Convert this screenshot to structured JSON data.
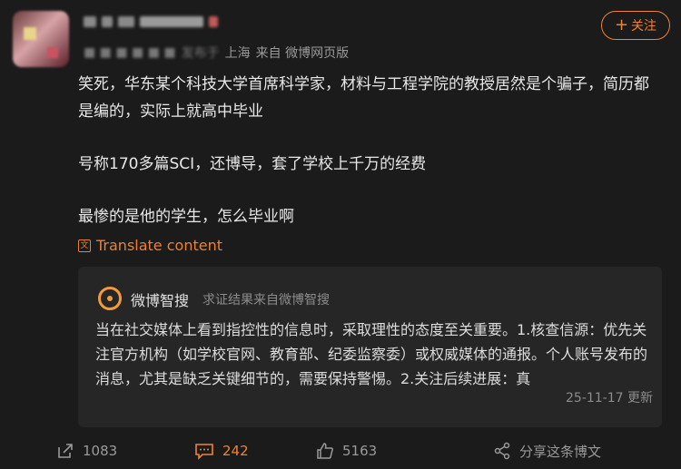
{
  "user": {
    "location_prefix": "发布于",
    "location": "上海",
    "source": "来自 微博网页版"
  },
  "follow": {
    "label": "关注",
    "icon": "plus-icon"
  },
  "post": {
    "lines": [
      "笑死，华东某个科技大学首席科学家，材料与工程学院的教授居然是个骗子，简历都是编的，实际上就高中毕业",
      "号称170多篇SCI，还博导，套了学校上千万的经费",
      "最惨的是他的学生，怎么毕业啊"
    ]
  },
  "translate": {
    "label": "Translate content",
    "icon": "translate-icon"
  },
  "card": {
    "title": "微博智搜",
    "subtitle": "求证结果来自微博智搜",
    "body": "当在社交媒体上看到指控性的信息时，采取理性的态度至关重要。1.核查信源：优先关注官方机构（如学校官网、教育部、纪委监察委）或权威媒体的通报。个人账号发布的消息，尤其是缺乏关键细节的，需要保持警惕。2.关注后续进展：真",
    "date": "25-11-17 更新"
  },
  "actions": {
    "repost": "1083",
    "comment": "242",
    "like": "5163",
    "share": "分享这条博文"
  },
  "colors": {
    "accent": "#ef8437",
    "background": "#1b1b1b"
  }
}
